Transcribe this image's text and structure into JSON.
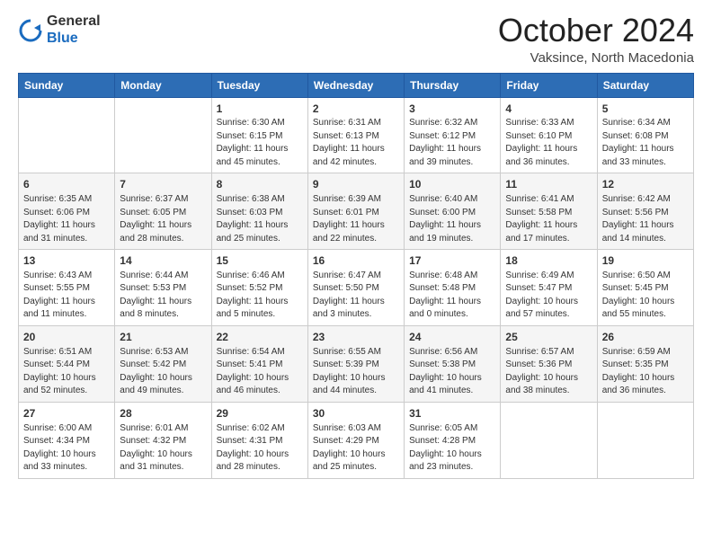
{
  "header": {
    "logo": {
      "general": "General",
      "blue": "Blue"
    },
    "title": "October 2024",
    "subtitle": "Vaksince, North Macedonia"
  },
  "calendar": {
    "days": [
      "Sunday",
      "Monday",
      "Tuesday",
      "Wednesday",
      "Thursday",
      "Friday",
      "Saturday"
    ],
    "weeks": [
      [
        {
          "day": "",
          "info": ""
        },
        {
          "day": "",
          "info": ""
        },
        {
          "day": "1",
          "info": "Sunrise: 6:30 AM\nSunset: 6:15 PM\nDaylight: 11 hours and 45 minutes."
        },
        {
          "day": "2",
          "info": "Sunrise: 6:31 AM\nSunset: 6:13 PM\nDaylight: 11 hours and 42 minutes."
        },
        {
          "day": "3",
          "info": "Sunrise: 6:32 AM\nSunset: 6:12 PM\nDaylight: 11 hours and 39 minutes."
        },
        {
          "day": "4",
          "info": "Sunrise: 6:33 AM\nSunset: 6:10 PM\nDaylight: 11 hours and 36 minutes."
        },
        {
          "day": "5",
          "info": "Sunrise: 6:34 AM\nSunset: 6:08 PM\nDaylight: 11 hours and 33 minutes."
        }
      ],
      [
        {
          "day": "6",
          "info": "Sunrise: 6:35 AM\nSunset: 6:06 PM\nDaylight: 11 hours and 31 minutes."
        },
        {
          "day": "7",
          "info": "Sunrise: 6:37 AM\nSunset: 6:05 PM\nDaylight: 11 hours and 28 minutes."
        },
        {
          "day": "8",
          "info": "Sunrise: 6:38 AM\nSunset: 6:03 PM\nDaylight: 11 hours and 25 minutes."
        },
        {
          "day": "9",
          "info": "Sunrise: 6:39 AM\nSunset: 6:01 PM\nDaylight: 11 hours and 22 minutes."
        },
        {
          "day": "10",
          "info": "Sunrise: 6:40 AM\nSunset: 6:00 PM\nDaylight: 11 hours and 19 minutes."
        },
        {
          "day": "11",
          "info": "Sunrise: 6:41 AM\nSunset: 5:58 PM\nDaylight: 11 hours and 17 minutes."
        },
        {
          "day": "12",
          "info": "Sunrise: 6:42 AM\nSunset: 5:56 PM\nDaylight: 11 hours and 14 minutes."
        }
      ],
      [
        {
          "day": "13",
          "info": "Sunrise: 6:43 AM\nSunset: 5:55 PM\nDaylight: 11 hours and 11 minutes."
        },
        {
          "day": "14",
          "info": "Sunrise: 6:44 AM\nSunset: 5:53 PM\nDaylight: 11 hours and 8 minutes."
        },
        {
          "day": "15",
          "info": "Sunrise: 6:46 AM\nSunset: 5:52 PM\nDaylight: 11 hours and 5 minutes."
        },
        {
          "day": "16",
          "info": "Sunrise: 6:47 AM\nSunset: 5:50 PM\nDaylight: 11 hours and 3 minutes."
        },
        {
          "day": "17",
          "info": "Sunrise: 6:48 AM\nSunset: 5:48 PM\nDaylight: 11 hours and 0 minutes."
        },
        {
          "day": "18",
          "info": "Sunrise: 6:49 AM\nSunset: 5:47 PM\nDaylight: 10 hours and 57 minutes."
        },
        {
          "day": "19",
          "info": "Sunrise: 6:50 AM\nSunset: 5:45 PM\nDaylight: 10 hours and 55 minutes."
        }
      ],
      [
        {
          "day": "20",
          "info": "Sunrise: 6:51 AM\nSunset: 5:44 PM\nDaylight: 10 hours and 52 minutes."
        },
        {
          "day": "21",
          "info": "Sunrise: 6:53 AM\nSunset: 5:42 PM\nDaylight: 10 hours and 49 minutes."
        },
        {
          "day": "22",
          "info": "Sunrise: 6:54 AM\nSunset: 5:41 PM\nDaylight: 10 hours and 46 minutes."
        },
        {
          "day": "23",
          "info": "Sunrise: 6:55 AM\nSunset: 5:39 PM\nDaylight: 10 hours and 44 minutes."
        },
        {
          "day": "24",
          "info": "Sunrise: 6:56 AM\nSunset: 5:38 PM\nDaylight: 10 hours and 41 minutes."
        },
        {
          "day": "25",
          "info": "Sunrise: 6:57 AM\nSunset: 5:36 PM\nDaylight: 10 hours and 38 minutes."
        },
        {
          "day": "26",
          "info": "Sunrise: 6:59 AM\nSunset: 5:35 PM\nDaylight: 10 hours and 36 minutes."
        }
      ],
      [
        {
          "day": "27",
          "info": "Sunrise: 6:00 AM\nSunset: 4:34 PM\nDaylight: 10 hours and 33 minutes."
        },
        {
          "day": "28",
          "info": "Sunrise: 6:01 AM\nSunset: 4:32 PM\nDaylight: 10 hours and 31 minutes."
        },
        {
          "day": "29",
          "info": "Sunrise: 6:02 AM\nSunset: 4:31 PM\nDaylight: 10 hours and 28 minutes."
        },
        {
          "day": "30",
          "info": "Sunrise: 6:03 AM\nSunset: 4:29 PM\nDaylight: 10 hours and 25 minutes."
        },
        {
          "day": "31",
          "info": "Sunrise: 6:05 AM\nSunset: 4:28 PM\nDaylight: 10 hours and 23 minutes."
        },
        {
          "day": "",
          "info": ""
        },
        {
          "day": "",
          "info": ""
        }
      ]
    ]
  }
}
